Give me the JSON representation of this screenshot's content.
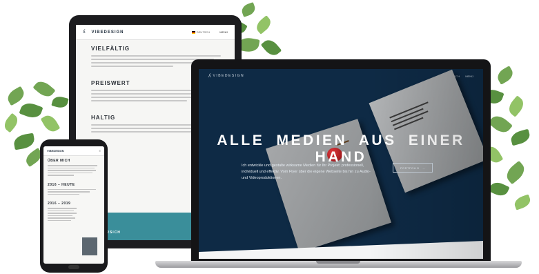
{
  "tablet": {
    "logo": "VIBEDESIGN",
    "lang": "DEUTSCH",
    "menu": "MENÜ",
    "sections": [
      {
        "heading": "VIELFÄLTIG"
      },
      {
        "heading": "PREISWERT"
      },
      {
        "heading": "HALTIG"
      }
    ],
    "footer_label": "ERSICH"
  },
  "phone": {
    "logo": "VIBEDESIGN",
    "menu": "≡",
    "sections": [
      {
        "heading": "ÜBER MICH"
      },
      {
        "heading": "2016 – HEUTE"
      },
      {
        "heading": "2016 – 2019"
      }
    ]
  },
  "laptop": {
    "logo": "VIBEDESIGN",
    "nav": {
      "lang": "DEUTSCH",
      "menu": "MENÜ"
    },
    "hero_title": "ALLE MEDIEN AUS EINER HAND",
    "hero_copy": "Ich entwickle und gestalte wirksame Medien für Ihr Projekt: professionell, individuell und effektiv. Vom Flyer über die eigene Webseite bis hin zu Audio- und Videoproduktionen.",
    "cta_label": "PORTFOLIO",
    "cta_arrow": "→"
  },
  "colors": {
    "hero_bg": "#0e2a45",
    "teal_accent": "#3a8e9a",
    "leaf_green": "#6aa04a"
  }
}
